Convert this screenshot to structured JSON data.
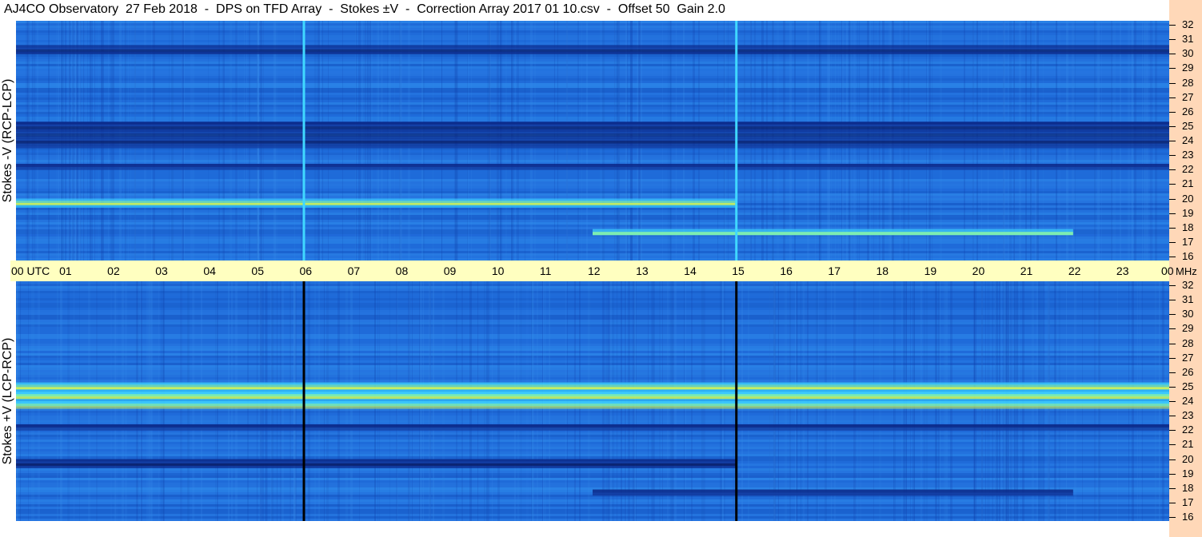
{
  "title": "AJ4CO Observatory  27 Feb 2018  -  DPS on TFD Array  -  Stokes ±V  -  Correction Array 2017 01 10.csv  -  Offset 50  Gain 2.0",
  "colors": {
    "strip": "#ffd8b8",
    "axis_band": "#ffffc0",
    "base_blue": "#1f6bd9"
  },
  "chart_data": [
    {
      "type": "heatmap",
      "ylabel": "Stokes -V (RCP-LCP)",
      "y_ticks": [
        32,
        31,
        30,
        29,
        28,
        27,
        26,
        25,
        24,
        23,
        22,
        21,
        20,
        19,
        18,
        17,
        16
      ],
      "ylim": [
        16,
        32
      ],
      "features": [
        {
          "kind": "band",
          "y": [
            19.4,
            20.0
          ],
          "x": [
            0,
            15
          ],
          "level": "high"
        },
        {
          "kind": "band",
          "y": [
            22.0,
            22.4
          ],
          "x": [
            0,
            24
          ],
          "level": "low"
        },
        {
          "kind": "band",
          "y": [
            23.5,
            25.3
          ],
          "x": [
            0,
            24
          ],
          "level": "low"
        },
        {
          "kind": "band",
          "y": [
            30.0,
            30.6
          ],
          "x": [
            0,
            24
          ],
          "level": "low"
        },
        {
          "kind": "band",
          "y": [
            17.5,
            17.9
          ],
          "x": [
            12,
            22
          ],
          "level": "high"
        },
        {
          "kind": "vline",
          "x": 6,
          "level": "high"
        },
        {
          "kind": "vline",
          "x": 15,
          "level": "high"
        }
      ]
    },
    {
      "type": "heatmap",
      "ylabel": "Stokes +V (LCP-RCP)",
      "y_ticks": [
        32,
        31,
        30,
        29,
        28,
        27,
        26,
        25,
        24,
        23,
        22,
        21,
        20,
        19,
        18,
        17,
        16
      ],
      "ylim": [
        16,
        32
      ],
      "features": [
        {
          "kind": "band",
          "y": [
            19.4,
            20.0
          ],
          "x": [
            0,
            15
          ],
          "level": "low"
        },
        {
          "kind": "band",
          "y": [
            22.0,
            22.4
          ],
          "x": [
            0,
            24
          ],
          "level": "low"
        },
        {
          "kind": "band",
          "y": [
            23.5,
            25.3
          ],
          "x": [
            0,
            24
          ],
          "level": "high"
        },
        {
          "kind": "band",
          "y": [
            17.5,
            17.9
          ],
          "x": [
            12,
            22
          ],
          "level": "low"
        },
        {
          "kind": "vline",
          "x": 6,
          "level": "low"
        },
        {
          "kind": "vline",
          "x": 15,
          "level": "low"
        }
      ]
    }
  ],
  "time_axis": {
    "labels": [
      "00  UTC",
      "01",
      "02",
      "03",
      "04",
      "05",
      "06",
      "07",
      "08",
      "09",
      "10",
      "11",
      "12",
      "13",
      "14",
      "15",
      "16",
      "17",
      "18",
      "19",
      "20",
      "21",
      "22",
      "23",
      "00"
    ],
    "unit": "MHz",
    "xlim": [
      0,
      24
    ]
  }
}
